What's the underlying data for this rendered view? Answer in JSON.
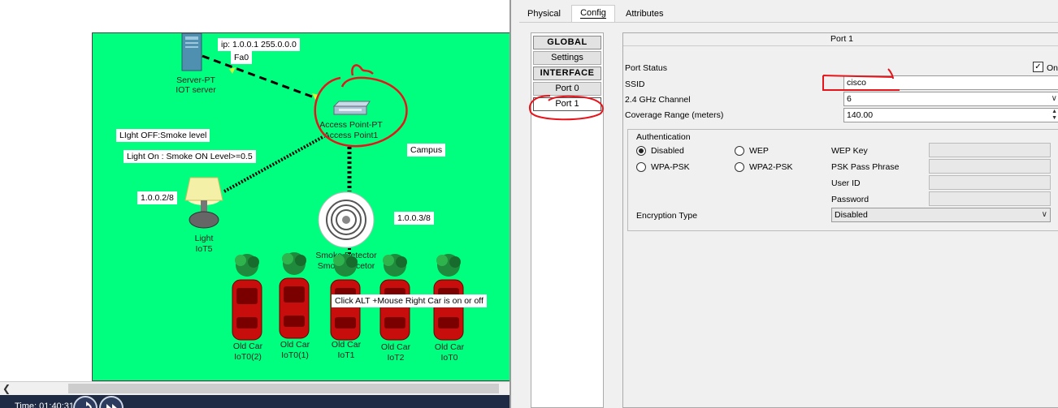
{
  "canvas": {
    "server": {
      "name": "Server-PT",
      "label": "IOT server"
    },
    "ip_label": "ip: 1.0.0.1 255.0.0.0",
    "port_label": "Fa0",
    "access_point": {
      "name": "Access Point-PT",
      "label": "Access Point1"
    },
    "note_light_off": "LIght OFF:Smoke level",
    "note_light_on": "Light On : Smoke ON Level>=0.5",
    "campus_label": "Campus",
    "light": {
      "ip": "1.0.0.2/8",
      "name": "Light",
      "label": "IoT5"
    },
    "smoke": {
      "ip": "1.0.0.3/8",
      "name": "Smoke Detector",
      "label": "Smoke decetor"
    },
    "cars": [
      {
        "name": "Old Car",
        "label": "IoT0(2)"
      },
      {
        "name": "Old Car",
        "label": "IoT0(1)"
      },
      {
        "name": "Old Car",
        "label": "IoT1"
      },
      {
        "name": "Old Car",
        "label": "IoT2"
      },
      {
        "name": "Old Car",
        "label": "IoT0"
      }
    ],
    "car_note": "Click ALT +Mouse Right Car is on or off"
  },
  "status": {
    "time": "Time: 01:40:31"
  },
  "dialog": {
    "tabs": [
      "Physical",
      "Config",
      "Attributes"
    ],
    "active_tab": "Config",
    "nav": {
      "global_header": "GLOBAL",
      "settings": "Settings",
      "interface_header": "INTERFACE",
      "port0": "Port 0",
      "port1": "Port 1"
    },
    "panel": {
      "title": "Port 1",
      "port_status_label": "Port Status",
      "port_status_on_label": "On",
      "port_status_on": true,
      "ssid_label": "SSID",
      "ssid_value": "cisco",
      "channel_label": "2.4 GHz Channel",
      "channel_value": "6",
      "coverage_label": "Coverage Range (meters)",
      "coverage_value": "140.00",
      "auth": {
        "title": "Authentication",
        "options": [
          "Disabled",
          "WEP",
          "WPA-PSK",
          "WPA2-PSK"
        ],
        "selected": "Disabled",
        "wep_key_label": "WEP Key",
        "psk_label": "PSK Pass Phrase",
        "userid_label": "User ID",
        "password_label": "Password"
      },
      "encryption_label": "Encryption Type",
      "encryption_value": "Disabled"
    }
  },
  "colors": {
    "canvas_bg": "#00ff7f",
    "annotation_red": "#e8141b",
    "status_bar": "#1f2b45"
  }
}
